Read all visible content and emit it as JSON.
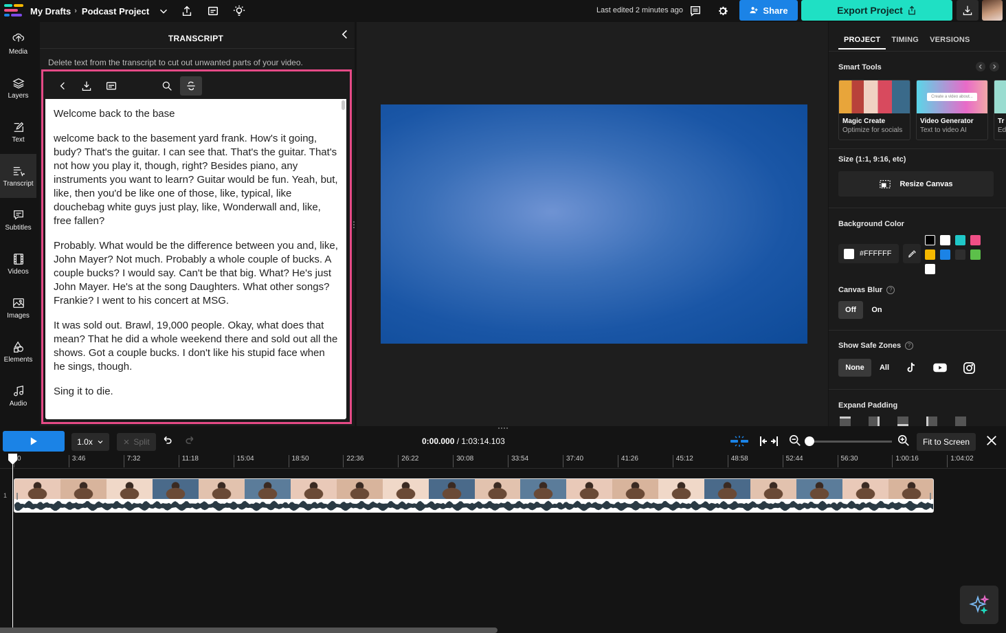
{
  "topbar": {
    "breadcrumb_root": "My Drafts",
    "breadcrumb_sep": "›",
    "project_name": "Podcast Project",
    "last_edited": "Last edited 2 minutes ago",
    "share_label": "Share",
    "export_label": "Export Project"
  },
  "nav": {
    "items": [
      {
        "label": "Media",
        "icon": "upload-icon"
      },
      {
        "label": "Layers",
        "icon": "layers-icon"
      },
      {
        "label": "Text",
        "icon": "text-icon"
      },
      {
        "label": "Transcript",
        "icon": "transcript-icon",
        "active": true
      },
      {
        "label": "Subtitles",
        "icon": "subtitles-icon"
      },
      {
        "label": "Videos",
        "icon": "film-icon"
      },
      {
        "label": "Images",
        "icon": "image-icon"
      },
      {
        "label": "Elements",
        "icon": "shapes-icon"
      },
      {
        "label": "Audio",
        "icon": "music-icon"
      }
    ]
  },
  "transcript": {
    "title": "TRANSCRIPT",
    "hint": "Delete text from the transcript to cut out unwanted parts of your video.",
    "paragraphs": [
      "Welcome back to the base",
      "welcome back to the basement yard frank. How's it going, budy? That's the guitar. I can see that. That's the guitar. That's not how you play it, though, right? Besides piano, any instruments you want to learn? Guitar would be fun. Yeah, but, like, then you'd be like one of those, like, typical, like douchebag white guys just play, like, Wonderwall and, like, free fallen?",
      "Probably. What would be the difference between you and, like, John Mayer? Not much. Probably a whole couple of bucks. A couple bucks? I would say. Can't be that big. What? He's just John Mayer. He's at the song Daughters. What other songs? Frankie? I went to his concert at MSG.",
      "It was sold out. Brawl, 19,000 people. Okay, what does that mean? That he did a whole weekend there and sold out all the shows. Got a couple bucks. I don't like his stupid face when he sings, though.",
      "Sing it to die."
    ]
  },
  "properties": {
    "tabs": [
      "PROJECT",
      "TIMING",
      "VERSIONS"
    ],
    "smart_tools_label": "Smart Tools",
    "cards": [
      {
        "title": "Magic Create",
        "subtitle": "Optimize for socials"
      },
      {
        "title": "Video Generator",
        "subtitle": "Text to video AI",
        "thumb_text": "Create a video about..."
      },
      {
        "title": "Tr",
        "subtitle": "Ed"
      }
    ],
    "size_label": "Size (1:1, 9:16, etc)",
    "resize_label": "Resize Canvas",
    "bg_label": "Background Color",
    "bg_hex": "#FFFFFF",
    "swatches": [
      "#000000",
      "#ffffff",
      "#1fc8c8",
      "#ef4f86",
      "#f5b800",
      "#1b83e6",
      "#2e2e2e",
      "#5cc04a",
      "#ffffff"
    ],
    "blur_label": "Canvas Blur",
    "blur_off": "Off",
    "blur_on": "On",
    "safe_label": "Show Safe Zones",
    "safe_none": "None",
    "safe_all": "All",
    "padding_label": "Expand Padding"
  },
  "controls": {
    "speed": "1.0x",
    "split": "Split",
    "time_current": "0:00.000",
    "time_total": "/ 1:03:14.103",
    "fit_label": "Fit to Screen",
    "zoom": 0.0
  },
  "timeline": {
    "ticks": [
      "0",
      "3:46",
      "7:32",
      "11:18",
      "15:04",
      "18:50",
      "22:36",
      "26:22",
      "30:08",
      "33:54",
      "37:40",
      "41:26",
      "45:12",
      "48:58",
      "52:44",
      "56:30",
      "1:00:16",
      "1:04:02"
    ],
    "track_number": "1"
  },
  "colors": {
    "accent": "#1b83e6",
    "export": "#1fe0c4",
    "highlight": "#e54a86"
  }
}
